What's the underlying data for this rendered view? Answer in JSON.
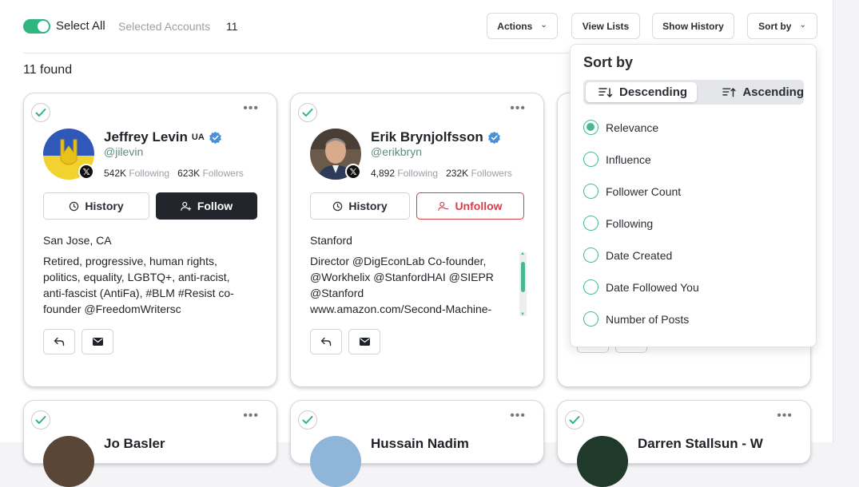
{
  "toolbar": {
    "select_all_label": "Select All",
    "selected_label": "Selected Accounts",
    "selected_count": "11",
    "actions_label": "Actions",
    "view_lists_label": "View Lists",
    "show_history_label": "Show History",
    "sort_by_label": "Sort by"
  },
  "results": {
    "found_label": "11  found"
  },
  "cards": [
    {
      "name": "Jeffrey Levin",
      "flag": "UA",
      "handle": "@jilevin",
      "following": "542K",
      "followers": "623K",
      "following_label": "Following",
      "followers_label": "Followers",
      "history_label": "History",
      "action_label": "Follow",
      "location": "San Jose, CA",
      "bio": "Retired, progressive, human rights, politics, equality, LGBTQ+, anti-racist, anti-fascist (AntiFa), #BLM #Resist co-founder @FreedomWritersc"
    },
    {
      "name": "Erik Brynjolfsson",
      "handle": "@erikbryn",
      "following": "4,892",
      "followers": "232K",
      "following_label": "Following",
      "followers_label": "Followers",
      "history_label": "History",
      "action_label": "Unfollow",
      "location": "Stanford",
      "bio_lines": [
        "Director @DigEconLab Co-founder,",
        "@Workhelix @StanfordHAI @SIEPR",
        "@Stanford",
        "www.amazon.com/Second-Machine-"
      ]
    }
  ],
  "bottom_cards": [
    {
      "name_partial": "Jo Basler"
    },
    {
      "name_partial": "Hussain Nadim"
    },
    {
      "name_partial": "Darren Stallsun - W"
    }
  ],
  "sort_menu": {
    "title": "Sort by",
    "descending_label": "Descending",
    "ascending_label": "Ascending",
    "options": [
      "Relevance",
      "Influence",
      "Follower Count",
      "Following",
      "Date Created",
      "Date Followed You",
      "Number of Posts"
    ],
    "selected": "Relevance"
  },
  "colors": {
    "accent": "#2fb57f",
    "follow_bg": "#23252c",
    "unfollow": "#d43f4a",
    "verified": "#4a90d9"
  }
}
